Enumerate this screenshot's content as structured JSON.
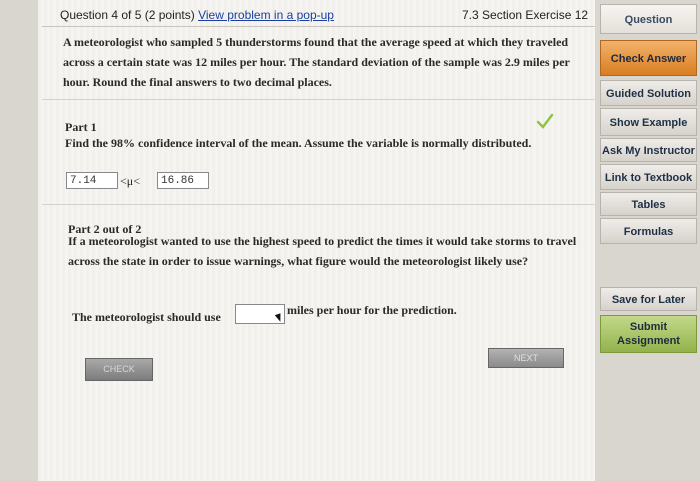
{
  "header": {
    "question_label": "Question 4 of 5 (2 points)",
    "popup_link": "View problem in a pop-up",
    "section_title": "7.3 Section Exercise 12"
  },
  "problem": {
    "statement": "A meteorologist who sampled 5 thunderstorms found that the average speed at which they traveled across a certain state was 12 miles per hour. The standard deviation of the sample was 2.9 miles per hour. Round the final answers to two decimal places."
  },
  "part1": {
    "title": "Part 1",
    "question": "Find the 98% confidence interval of the mean. Assume the variable is normally distributed.",
    "lower_value": "7.14",
    "interval_text": "<μ<",
    "upper_value": "16.86"
  },
  "part2": {
    "title": "Part 2 out of 2",
    "question": "If a meteorologist wanted to use the highest speed to predict the times it would take storms to travel across the state in order to issue warnings, what figure would the meteorologist likely use?",
    "answer_prefix": "The meteorologist should use",
    "answer_value": "",
    "answer_suffix": "miles per hour for the prediction."
  },
  "buttons": {
    "check": "CHECK",
    "next": "NEXT"
  },
  "sidebar": {
    "question": "Question",
    "check_answer": "Check Answer",
    "guided_solution": "Guided Solution",
    "show_example": "Show Example",
    "ask_instructor": "Ask My Instructor",
    "link_textbook": "Link to Textbook",
    "tables": "Tables",
    "formulas": "Formulas",
    "save_later": "Save for Later",
    "submit_assignment": "Submit Assignment"
  },
  "colors": {
    "orange_accent": "#e5913b",
    "green_accent": "#a8c45e",
    "check_mark": "#8cc63f"
  }
}
